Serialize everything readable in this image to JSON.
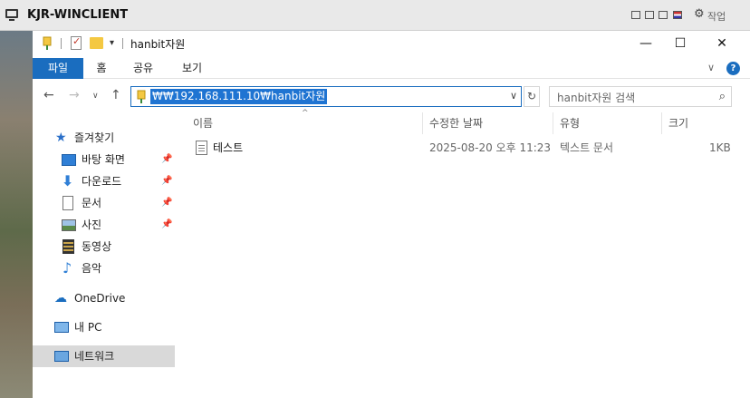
{
  "remote_title": "KJR-WINCLIENT",
  "remote_menu_label": "작업",
  "window": {
    "title": "hanbit자원",
    "minimize": "—",
    "maximize": "☐",
    "close": "✕"
  },
  "ribbon": {
    "tabs": [
      "파일",
      "홈",
      "공유",
      "보기"
    ]
  },
  "nav": {
    "back": "←",
    "forward": "→",
    "recent": "∨",
    "up": "↑",
    "address": "₩₩192.168.111.10₩hanbit자원",
    "refresh": "↻",
    "search_placeholder": "hanbit자원 검색"
  },
  "sidebar": {
    "items": [
      {
        "label": "즐겨찾기",
        "icon": "star-icon"
      },
      {
        "label": "바탕 화면",
        "icon": "desktop-icon",
        "pinned": true
      },
      {
        "label": "다운로드",
        "icon": "download-icon",
        "pinned": true
      },
      {
        "label": "문서",
        "icon": "document-icon",
        "pinned": true
      },
      {
        "label": "사진",
        "icon": "pictures-icon",
        "pinned": true
      },
      {
        "label": "동영상",
        "icon": "video-icon"
      },
      {
        "label": "음악",
        "icon": "music-icon"
      },
      {
        "label": "OneDrive",
        "icon": "cloud-icon"
      },
      {
        "label": "내 PC",
        "icon": "computer-icon"
      },
      {
        "label": "네트워크",
        "icon": "network-icon"
      }
    ]
  },
  "columns": [
    "이름",
    "수정한 날짜",
    "유형",
    "크기"
  ],
  "files": [
    {
      "name": "테스트",
      "modified": "2025-08-20 오후 11:23",
      "type": "텍스트 문서",
      "size": "1KB"
    }
  ],
  "colors": {
    "accent": "#1a6dbf",
    "selection": "#1f74d2",
    "folder": "#f4c842"
  }
}
